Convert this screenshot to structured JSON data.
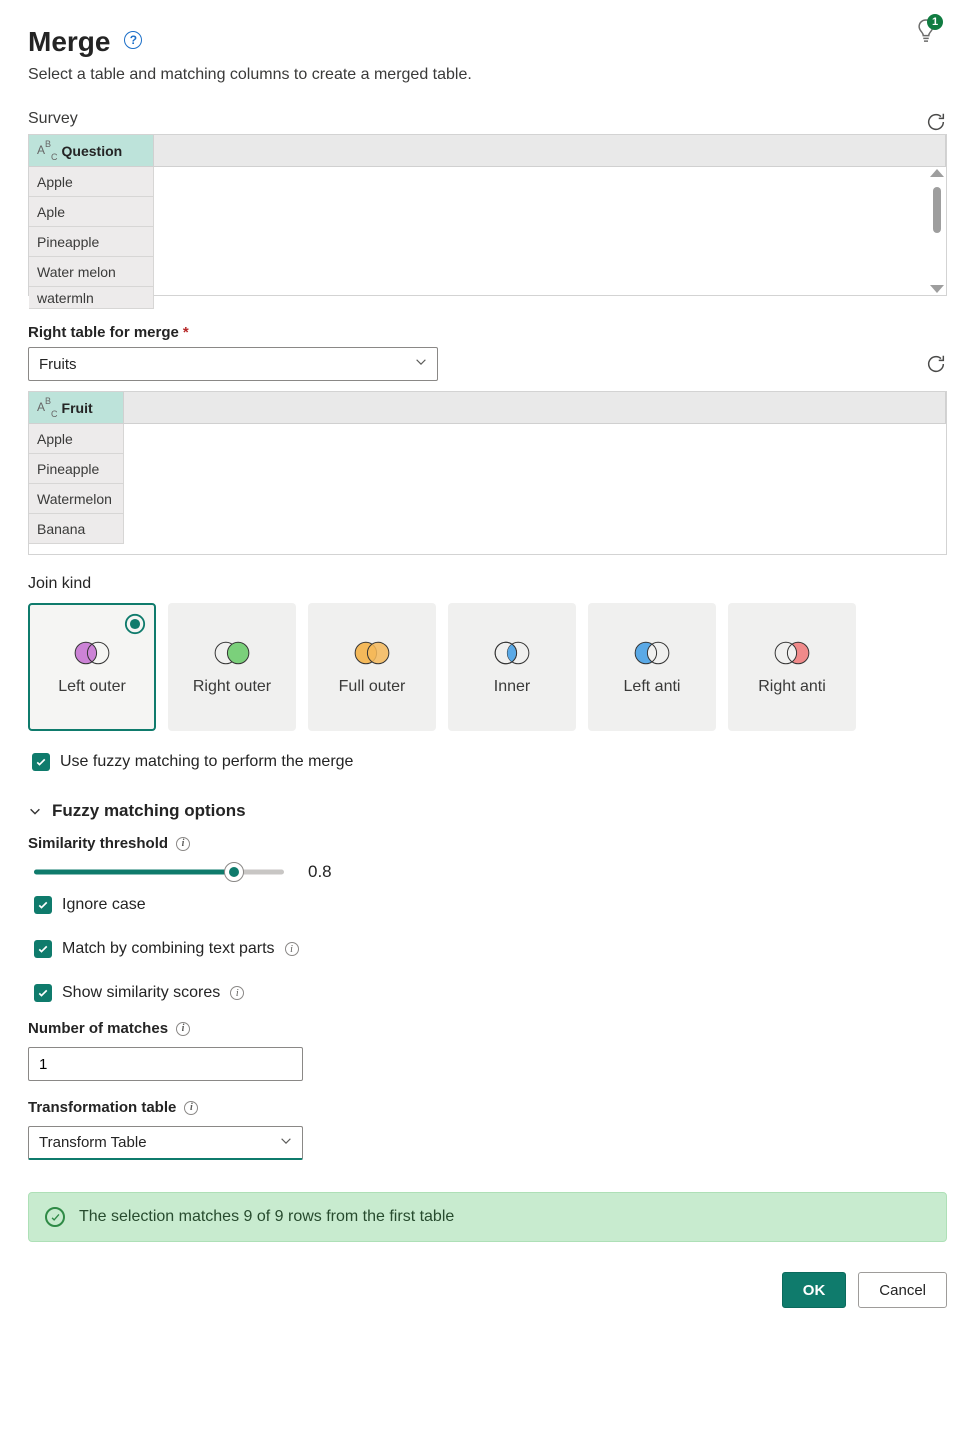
{
  "header": {
    "title": "Merge",
    "subtitle": "Select a table and matching columns to create a merged table.",
    "hint_badge": "1"
  },
  "left_table": {
    "label": "Survey",
    "column_header": "Question",
    "rows": [
      "Apple",
      "Aple",
      "Pineapple",
      "Water melon",
      "watermln"
    ]
  },
  "right_section": {
    "label": "Right table for merge",
    "select_value": "Fruits",
    "column_header": "Fruit",
    "rows": [
      "Apple",
      "Pineapple",
      "Watermelon",
      "Banana"
    ]
  },
  "join": {
    "label": "Join kind",
    "options": [
      {
        "id": "left-outer",
        "label": "Left outer"
      },
      {
        "id": "right-outer",
        "label": "Right outer"
      },
      {
        "id": "full-outer",
        "label": "Full outer"
      },
      {
        "id": "inner",
        "label": "Inner"
      },
      {
        "id": "left-anti",
        "label": "Left anti"
      },
      {
        "id": "right-anti",
        "label": "Right anti"
      }
    ],
    "selected": "left-outer"
  },
  "fuzzy": {
    "checkbox_label": "Use fuzzy matching to perform the merge",
    "expander_label": "Fuzzy matching options",
    "similarity_label": "Similarity threshold",
    "similarity_value": "0.8",
    "similarity_percent": 80,
    "ignore_case_label": "Ignore case",
    "combine_label": "Match by combining text parts",
    "show_scores_label": "Show similarity scores",
    "num_matches_label": "Number of matches",
    "num_matches_value": "1",
    "transform_label": "Transformation table",
    "transform_value": "Transform Table"
  },
  "status": {
    "text": "The selection matches 9 of 9 rows from the first table"
  },
  "buttons": {
    "ok": "OK",
    "cancel": "Cancel"
  }
}
